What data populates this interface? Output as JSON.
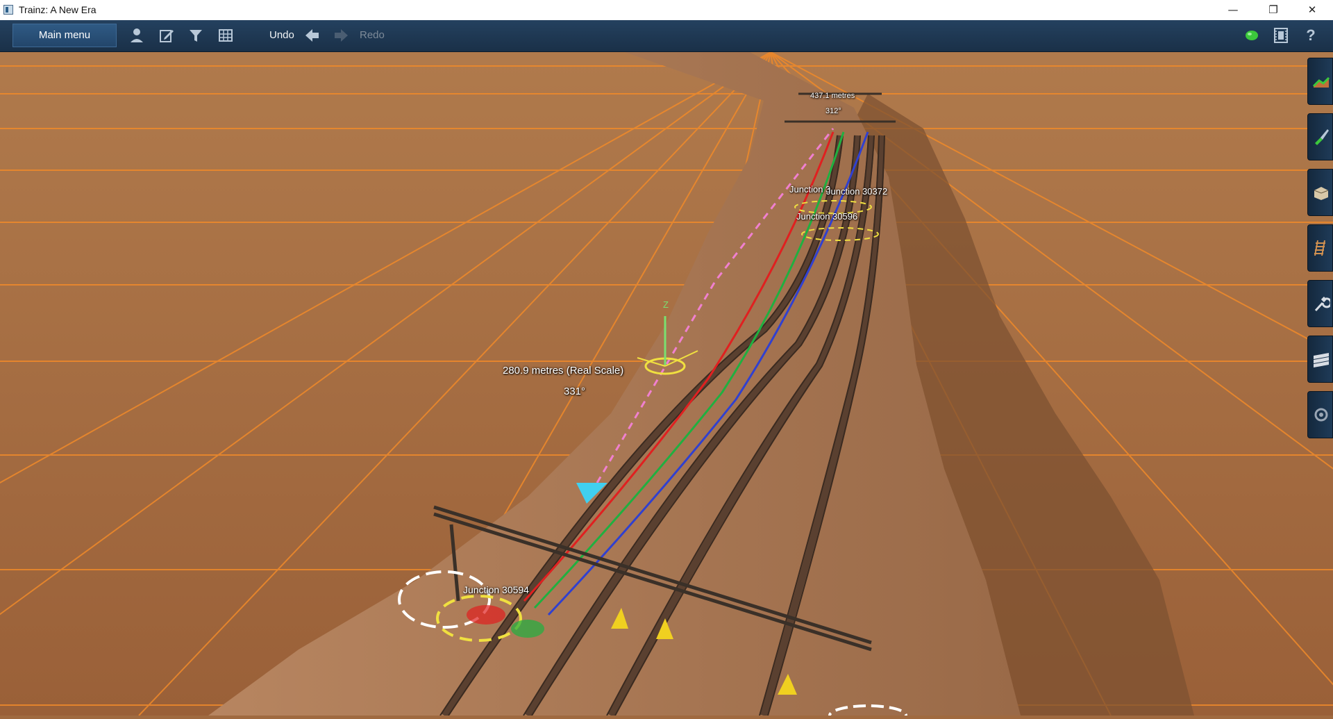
{
  "window": {
    "title": "Trainz: A New Era",
    "controls": {
      "minimize": "—",
      "restore": "❐",
      "close": "✕"
    }
  },
  "toolbar": {
    "main_menu_label": "Main menu",
    "undo_label": "Undo",
    "redo_label": "Redo",
    "icons": [
      "person-icon",
      "edit-icon",
      "filter-icon",
      "grid-icon",
      "undo-arrow-icon",
      "redo-arrow-icon",
      "status-indicator-icon",
      "film-icon",
      "help-icon"
    ],
    "help_glyph": "?",
    "status_color": "#3cc83c"
  },
  "scene": {
    "labels": {
      "measurement_near": "280.9 metres (Real Scale)",
      "angle_near": "331°",
      "measurement_far": "437.1 metres",
      "angle_far": "312°",
      "junction_a": "Junction 30594",
      "junction_b": "Junction 30372",
      "junction_b_overlap": "Junction 3",
      "junction_c": "Junction 30596"
    },
    "colors": {
      "ground": "#a06a40",
      "grid_line": "#f08a2a",
      "embankment": "#b07a52",
      "track_red": "#e02020",
      "track_green": "#20b040",
      "track_blue": "#3040d0",
      "gizmo": "#f0e040",
      "direction_marker": "#40d0f0"
    }
  },
  "palette": {
    "items": [
      "terrain-tool-icon",
      "paint-tool-icon",
      "object-tool-icon",
      "track-tool-icon",
      "wrench-tool-icon",
      "layers-tool-icon",
      "settings-tool-icon"
    ]
  }
}
